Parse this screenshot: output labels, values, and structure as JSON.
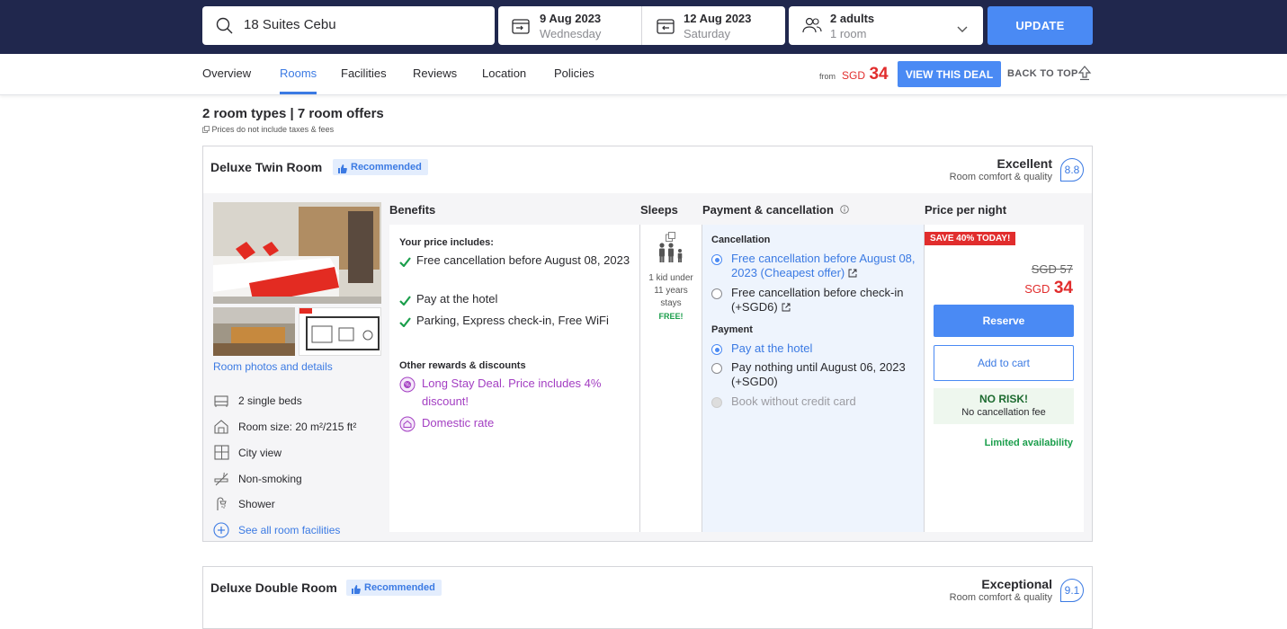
{
  "search": {
    "query": "18 Suites Cebu",
    "checkin_date": "9 Aug 2023",
    "checkin_day": "Wednesday",
    "checkout_date": "12 Aug 2023",
    "checkout_day": "Saturday",
    "guests": "2 adults",
    "rooms": "1 room",
    "update_label": "UPDATE"
  },
  "nav": {
    "tabs": [
      "Overview",
      "Rooms",
      "Facilities",
      "Reviews",
      "Location",
      "Policies"
    ],
    "active_tab": "Rooms",
    "from_label": "from",
    "from_currency": "SGD",
    "from_amount": "34",
    "view_deal_label": "VIEW THIS DEAL",
    "back_to_top_label": "BACK TO TOP"
  },
  "summary": {
    "title": "2 room types | 7 room offers",
    "tax_note": "Prices do not include taxes & fees"
  },
  "rooms": [
    {
      "name": "Deluxe Twin Room",
      "badge": "Recommended",
      "rating_label": "Excellent",
      "rating_sub": "Room comfort & quality",
      "score": "8.8",
      "photos_link": "Room photos and details",
      "features": [
        "2 single beds",
        "Room size: 20 m²/215 ft²",
        "City view",
        "Non-smoking",
        "Shower"
      ],
      "see_all": "See all room facilities",
      "columns": {
        "benefits": "Benefits",
        "sleeps": "Sleeps",
        "payment": "Payment & cancellation",
        "price": "Price per night"
      },
      "benefits": {
        "heading": "Your price includes:",
        "items": [
          "Free cancellation before August 08, 2023",
          "Pay at the hotel",
          "Parking, Express check-in, Free WiFi"
        ],
        "rewards_heading": "Other rewards & discounts",
        "rewards": [
          "Long Stay Deal. Price includes 4% discount!",
          "Domestic rate"
        ]
      },
      "sleeps": {
        "line1": "1 kid under",
        "line2": "11 years",
        "line3": "stays",
        "free": "FREE!"
      },
      "payment": {
        "cancellation_heading": "Cancellation",
        "cancellation_options": [
          "Free cancellation before August 08, 2023 (Cheapest offer)",
          "Free cancellation before check-in (+SGD6)"
        ],
        "payment_heading": "Payment",
        "payment_options": [
          "Pay at the hotel",
          "Pay nothing until August 06, 2023 (+SGD0)",
          "Book without credit card"
        ]
      },
      "price": {
        "tag": "SAVE 40% TODAY!",
        "old": "SGD 57",
        "currency": "SGD",
        "amount": "34",
        "reserve_label": "Reserve",
        "cart_label": "Add to cart",
        "norisk_title": "NO RISK!",
        "norisk_sub": "No cancellation fee",
        "availability": "Limited availability"
      }
    },
    {
      "name": "Deluxe Double Room",
      "badge": "Recommended",
      "rating_label": "Exceptional",
      "rating_sub": "Room comfort & quality",
      "score": "9.1"
    }
  ],
  "colors": {
    "header_bg": "#20274d",
    "accent": "#4a8af4",
    "price_red": "#e12d2d",
    "reward_purple": "#a33ec2",
    "success_green": "#1a9e4b"
  }
}
